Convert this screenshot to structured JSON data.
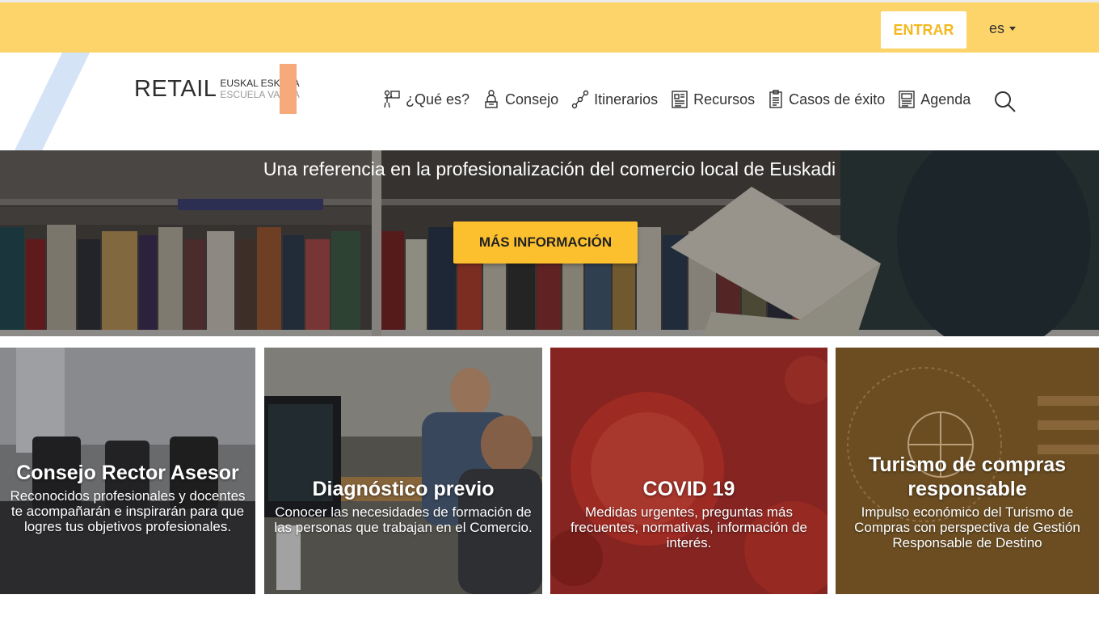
{
  "topbar": {
    "login_label": "ENTRAR",
    "language": "es"
  },
  "logo": {
    "main": "RETAIL",
    "line1": "EUSKAL ESKOLA",
    "line2": "ESCUELA VASCA",
    "accent_color": "#f6a97a"
  },
  "nav": {
    "items": [
      {
        "label": "¿Qué es?",
        "icon": "presenter-icon"
      },
      {
        "label": "Consejo",
        "icon": "council-icon"
      },
      {
        "label": "Itinerarios",
        "icon": "route-icon"
      },
      {
        "label": "Recursos",
        "icon": "resources-icon"
      },
      {
        "label": "Casos de éxito",
        "icon": "document-icon"
      },
      {
        "label": "Agenda",
        "icon": "agenda-icon"
      }
    ]
  },
  "hero": {
    "title": "Una referencia en la profesionalización del comercio local de Euskadi",
    "button_label": "MÁS INFORMACIÓN"
  },
  "cards": [
    {
      "title": "Consejo Rector Asesor",
      "text": "Reconocidos profesionales y docentes te acompañarán e inspirarán para que logres tus objetivos profesionales."
    },
    {
      "title": "Diagnóstico previo",
      "text": "Conocer las necesidades de formación de las personas que trabajan en el Comercio."
    },
    {
      "title": "COVID 19",
      "text": "Medidas urgentes, preguntas más frecuentes, normativas, información de interés."
    },
    {
      "title": "Turismo de compras responsable",
      "text": "Impulso económico del Turismo de Compras con perspectiva de Gestión Responsable de Destino"
    }
  ],
  "colors": {
    "topbar": "#fdd46a",
    "button": "#fcc02e",
    "login_text": "#f4b81f"
  }
}
